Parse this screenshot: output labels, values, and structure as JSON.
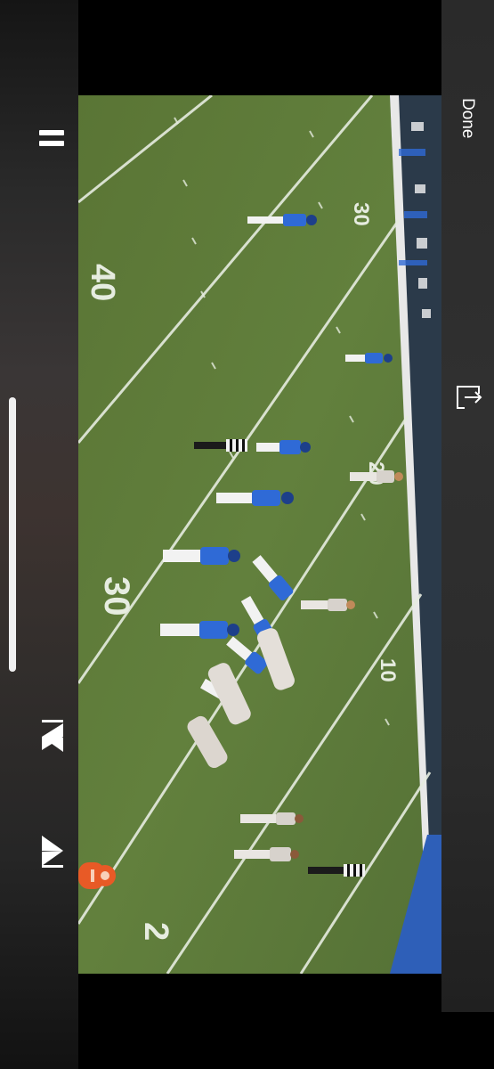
{
  "player": {
    "done_label": "Done",
    "progress_fraction": 1.0
  },
  "controls": {
    "pause_icon": "pause-icon",
    "share_icon": "share-icon",
    "skip_back_icon": "skip-back-icon",
    "skip_forward_icon": "skip-forward-icon"
  },
  "field_markings": {
    "yard_40": "40",
    "yard_30_left": "30",
    "yard_30_right": "30",
    "yard_20": "20",
    "yard_10": "10",
    "yard_2": "2"
  },
  "colors": {
    "field_green": "#5f7a3a",
    "home_jersey": "#2f6ad6",
    "away_jersey": "#e9e6e2",
    "sideline_blue": "#2e5fb8"
  }
}
